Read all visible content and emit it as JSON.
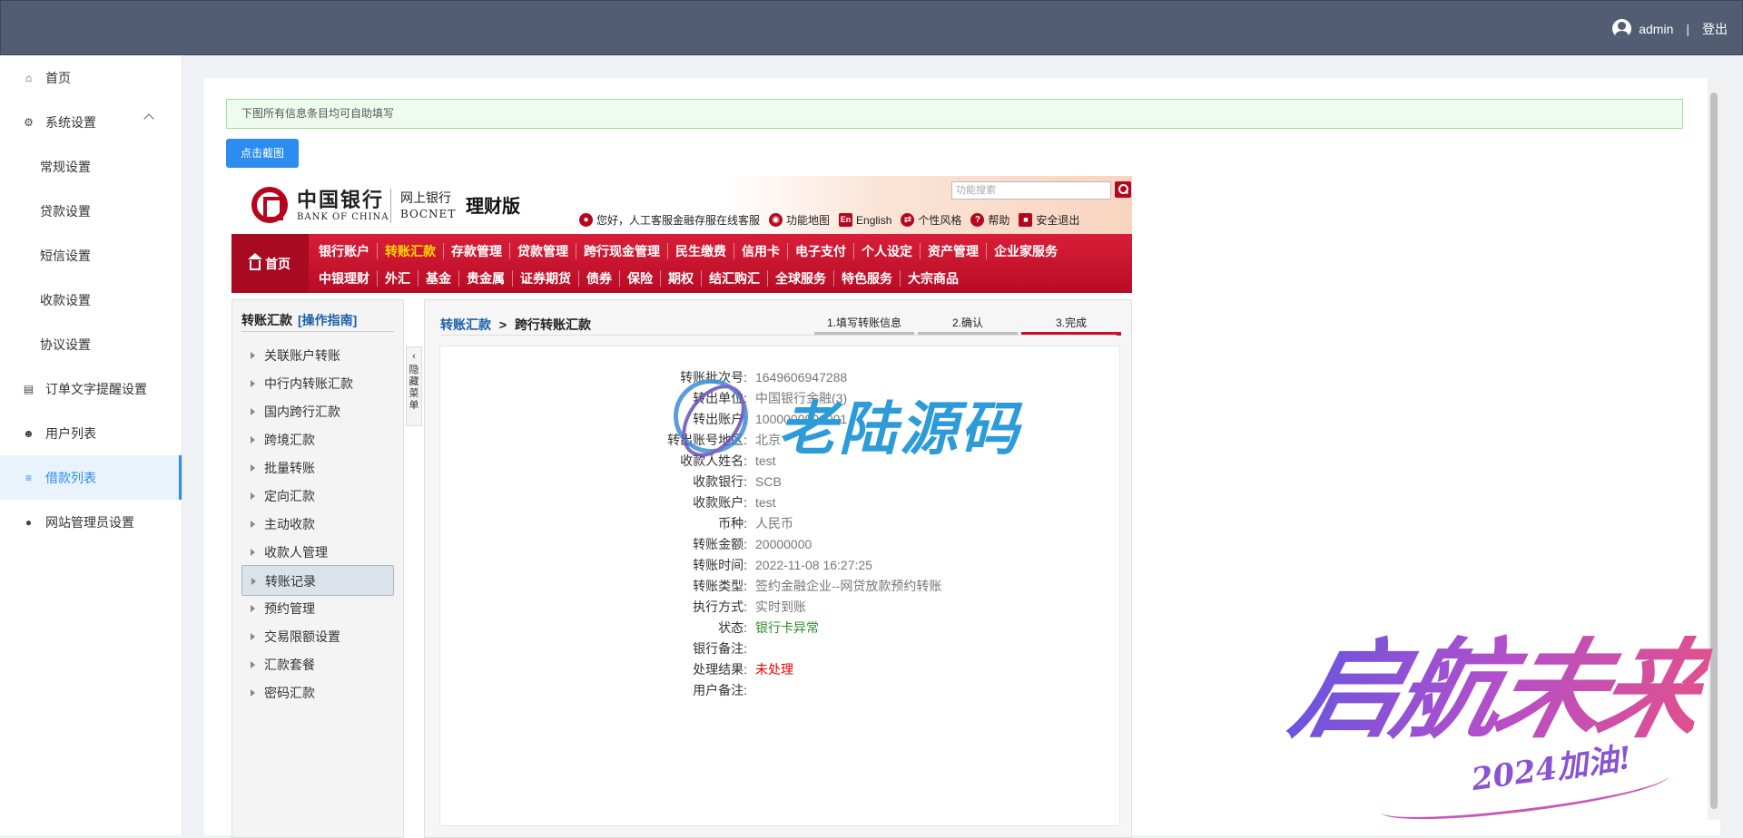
{
  "topbar": {
    "username": "admin",
    "separator": "|",
    "logout": "登出"
  },
  "sidebar": {
    "items": [
      {
        "label": "首页",
        "icon": "home-icon"
      },
      {
        "label": "系统设置",
        "icon": "gear-icon"
      },
      {
        "label": "常规设置"
      },
      {
        "label": "贷款设置"
      },
      {
        "label": "短信设置"
      },
      {
        "label": "收款设置"
      },
      {
        "label": "协议设置"
      },
      {
        "label": "订单文字提醒设置",
        "icon": "document-icon"
      },
      {
        "label": "用户列表",
        "icon": "users-icon"
      },
      {
        "label": "借款列表",
        "icon": "list-icon"
      },
      {
        "label": "网站管理员设置",
        "icon": "user-icon"
      }
    ]
  },
  "notice": "下图所有信息条目均可自助填写",
  "screenshot_button": "点击截图",
  "bank": {
    "name_cn": "中国银行",
    "name_en": "BANK OF CHINA",
    "wangshang": "网上银行",
    "bocnet": "BOCNET",
    "edition": "理财版",
    "search_placeholder": "功能搜索",
    "toplinks": [
      "您好，人工客服金融存服在线客服",
      "功能地图",
      "English",
      "个性风格",
      "帮助",
      "安全退出"
    ],
    "home": "首页",
    "menu_row1": [
      "银行账户",
      "转账汇款",
      "存款管理",
      "贷款管理",
      "跨行现金管理",
      "民生缴费",
      "信用卡",
      "电子支付",
      "个人设定",
      "资产管理",
      "企业家服务"
    ],
    "menu_row2": [
      "中银理财",
      "外汇",
      "基金",
      "贵金属",
      "证券期货",
      "债券",
      "保险",
      "期权",
      "结汇购汇",
      "全球服务",
      "特色服务",
      "大宗商品"
    ],
    "leftnav_title": "转账汇款",
    "leftnav_guide": "[操作指南]",
    "leftnav_items": [
      "关联账户转账",
      "中行内转账汇款",
      "国内跨行汇款",
      "跨境汇款",
      "批量转账",
      "定向汇款",
      "主动收款",
      "收款人管理",
      "转账记录",
      "预约管理",
      "交易限额设置",
      "汇款套餐",
      "密码汇款"
    ],
    "collapse_label": "隐藏菜单",
    "crumb_link": "转账汇款",
    "crumb_sep": ">",
    "crumb_current": "跨行转账汇款",
    "steps": [
      "1.填写转账信息",
      "2.确认",
      "3.完成"
    ],
    "details": [
      {
        "k": "转账批次号:",
        "v": "1649606947288"
      },
      {
        "k": "转出单位:",
        "v": "中国银行金融(3)"
      },
      {
        "k": "转出账户:",
        "v": "1000000001001"
      },
      {
        "k": "转出账号地区:",
        "v": "北京"
      },
      {
        "k": "收款人姓名:",
        "v": "test"
      },
      {
        "k": "收款银行:",
        "v": "SCB"
      },
      {
        "k": "收款账户:",
        "v": "test"
      },
      {
        "k": "币种:",
        "v": "人民币"
      },
      {
        "k": "转账金额:",
        "v": "20000000"
      },
      {
        "k": "转账时间:",
        "v": "2022-11-08 16:27:25"
      },
      {
        "k": "转账类型:",
        "v": "签约金融企业--网贷放款预约转账"
      },
      {
        "k": "执行方式:",
        "v": "实时到账"
      },
      {
        "k": "状态:",
        "v": "银行卡异常"
      },
      {
        "k": "银行备注:",
        "v": ""
      },
      {
        "k": "处理结果:",
        "v": "未处理"
      },
      {
        "k": "用户备注:",
        "v": ""
      }
    ]
  },
  "watermark1": "老陆源码",
  "watermark2": {
    "main": "启航未来",
    "sub": "2024加油!"
  },
  "colors": {
    "topbar": "#525d73",
    "accent": "#2d8cf0",
    "boc_red": "#c8102e",
    "status_green": "#2e8b2e",
    "result_red": "#ee0000"
  }
}
